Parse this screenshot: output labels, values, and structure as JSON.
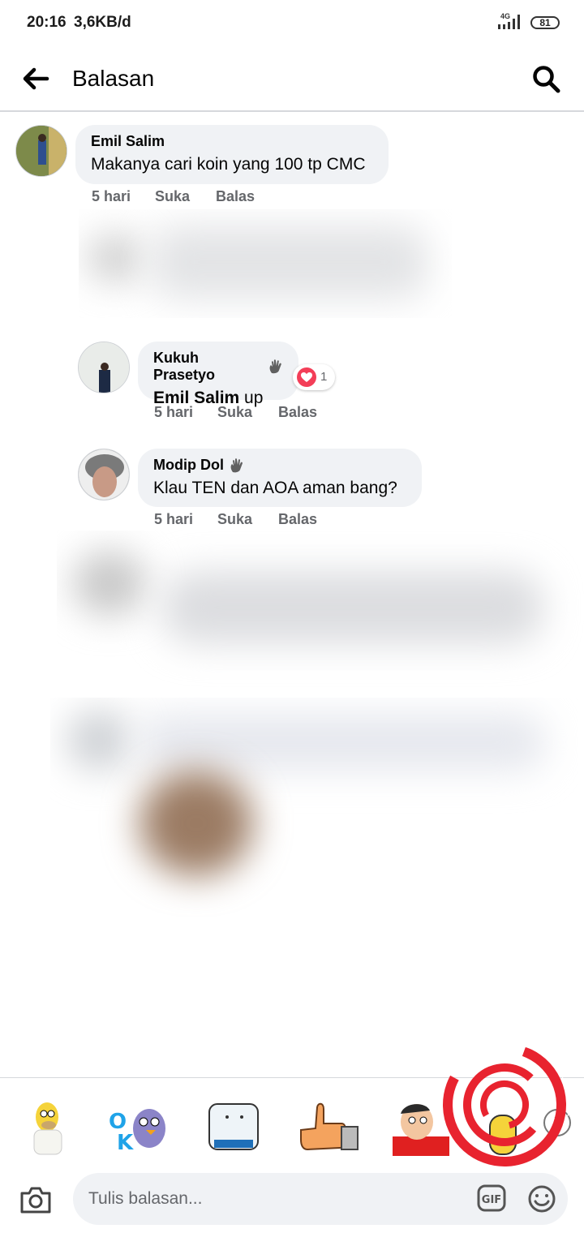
{
  "status_bar": {
    "time": "20:16",
    "speed": "3,6KB/d",
    "network": "4G",
    "battery": "81"
  },
  "header": {
    "title": "Balasan"
  },
  "comments": [
    {
      "author": "Emil Salim",
      "text": "Makanya cari koin yang 100 tp CMC",
      "time": "5 hari",
      "like": "Suka",
      "reply": "Balas"
    },
    {
      "author": "Kukuh Prasetyo",
      "mention": "Emil Salim",
      "text": " up",
      "time": "5 hari",
      "like": "Suka",
      "reply": "Balas",
      "reaction_count": "1"
    },
    {
      "author": "Modip Dol",
      "text": "Klau TEN dan AOA aman bang?",
      "time": "5 hari",
      "like": "Suka",
      "reply": "Balas"
    }
  ],
  "composer": {
    "placeholder": "Tulis balasan...",
    "gif_label": "GIF"
  },
  "icons": [
    "back-arrow-icon",
    "search-icon",
    "wave-icon",
    "heart-reaction-icon",
    "camera-icon",
    "gif-icon",
    "emoji-icon"
  ],
  "colors": {
    "bubble": "#f0f2f5",
    "meta_text": "#65676b",
    "reaction": "#f33e58",
    "watermark": "#e8232f"
  }
}
